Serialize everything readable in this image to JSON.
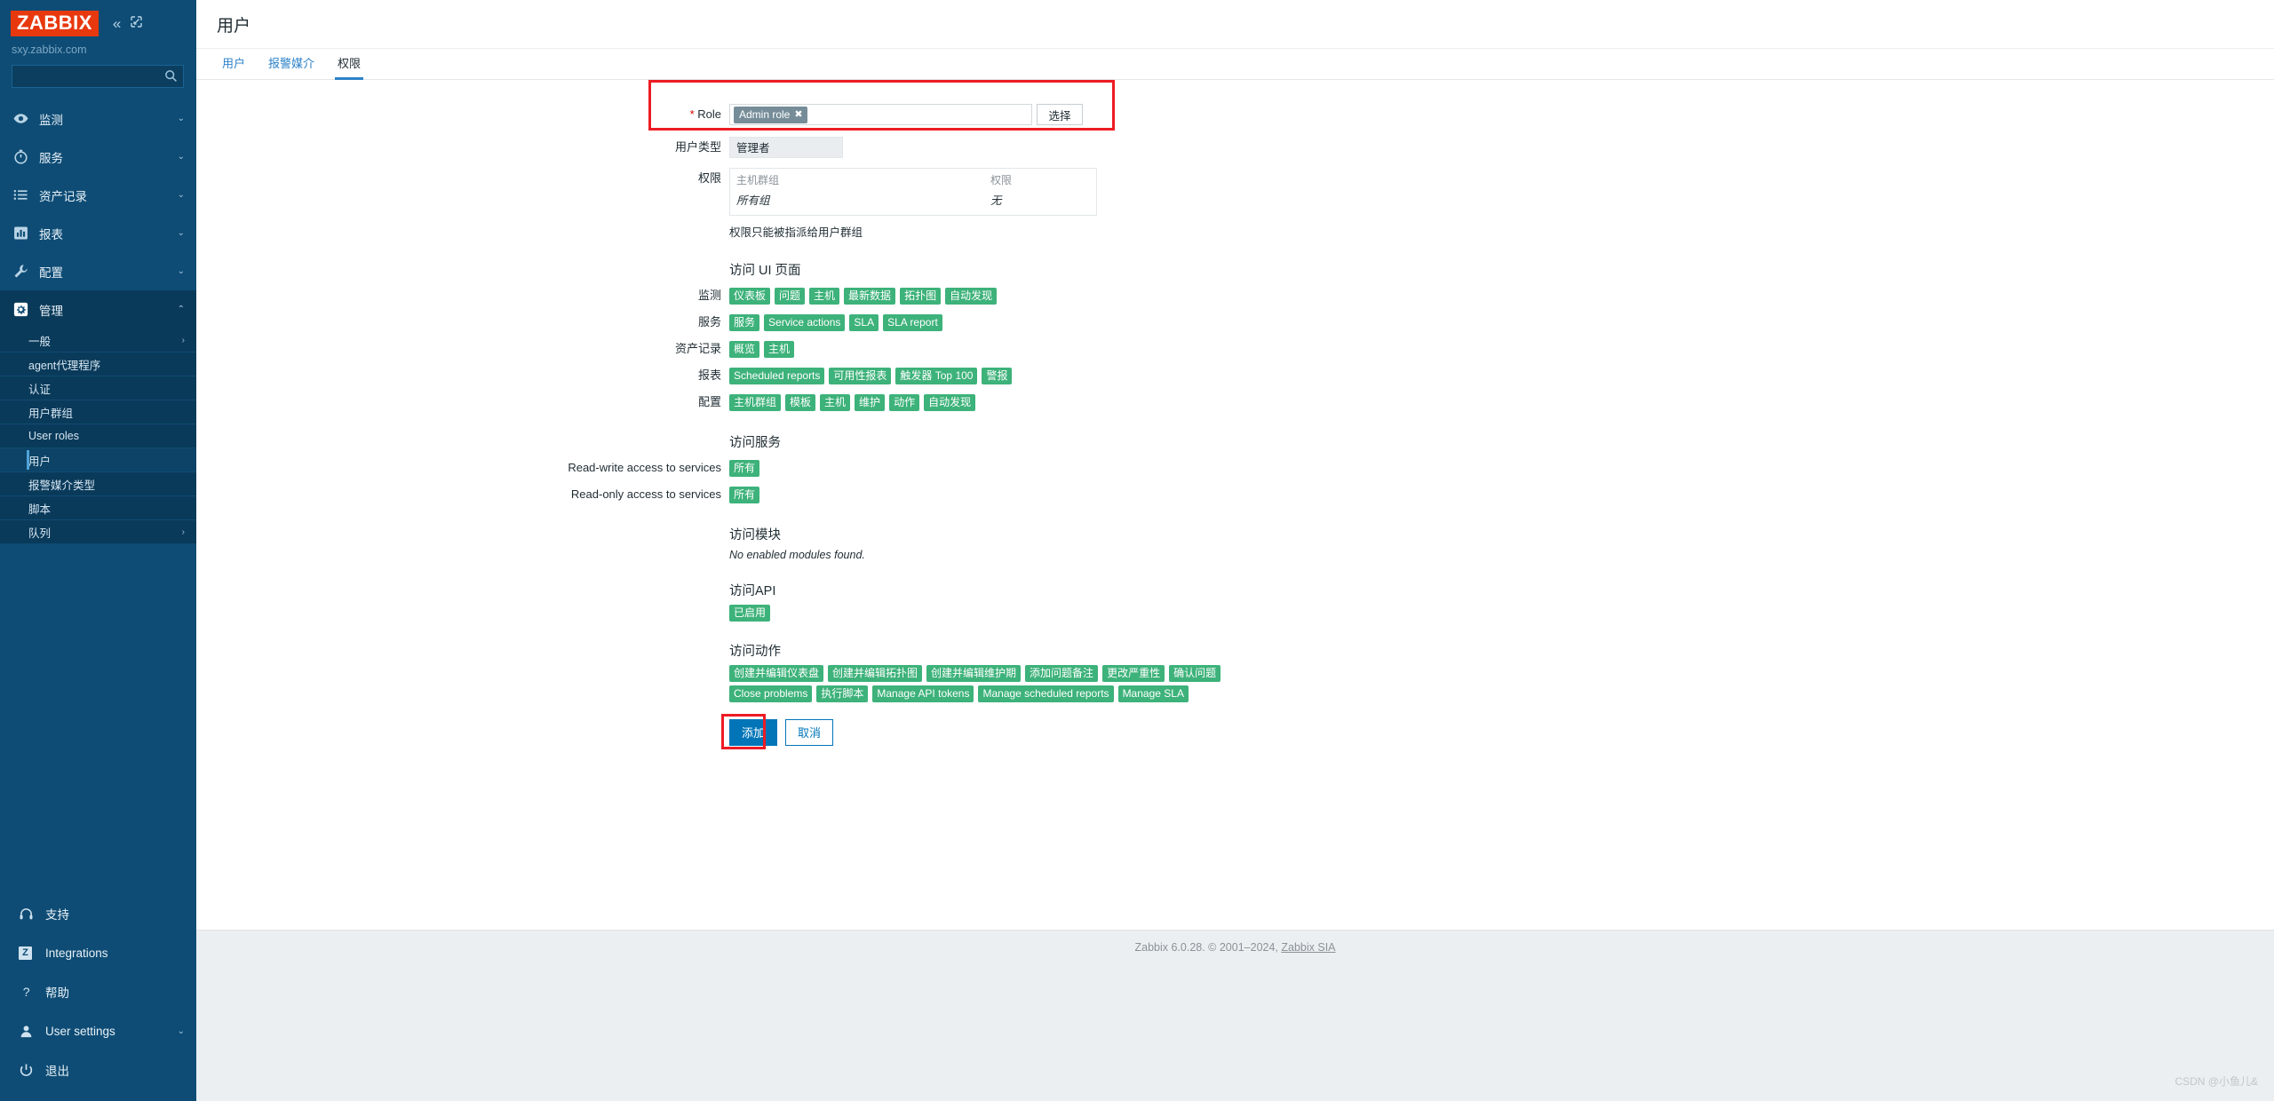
{
  "sidebar": {
    "logo": "ZABBIX",
    "collapse_icon": "chevron-double-left-icon",
    "expand_icon": "expand-icon",
    "server": "sxy.zabbix.com",
    "search": {
      "value": "",
      "placeholder": "",
      "icon": "search-icon"
    },
    "nav": [
      {
        "label": "监测",
        "icon": "eye-icon",
        "chev": "⌄",
        "active": false
      },
      {
        "label": "服务",
        "icon": "clock-icon",
        "chev": "⌄",
        "active": false
      },
      {
        "label": "资产记录",
        "icon": "list-icon",
        "chev": "⌄",
        "active": false
      },
      {
        "label": "报表",
        "icon": "chart-icon",
        "chev": "⌄",
        "active": false
      },
      {
        "label": "配置",
        "icon": "wrench-icon",
        "chev": "⌄",
        "active": false
      },
      {
        "label": "管理",
        "icon": "gear-icon",
        "chev": "⌃",
        "active": true
      }
    ],
    "subnav": [
      {
        "label": "一般",
        "chev": "›",
        "selected": false
      },
      {
        "label": "agent代理程序",
        "chev": "",
        "selected": false
      },
      {
        "label": "认证",
        "chev": "",
        "selected": false
      },
      {
        "label": "用户群组",
        "chev": "",
        "selected": false
      },
      {
        "label": "User roles",
        "chev": "",
        "selected": false
      },
      {
        "label": "用户",
        "chev": "",
        "selected": true
      },
      {
        "label": "报警媒介类型",
        "chev": "",
        "selected": false
      },
      {
        "label": "脚本",
        "chev": "",
        "selected": false
      },
      {
        "label": "队列",
        "chev": "›",
        "selected": false
      }
    ],
    "bottom": [
      {
        "label": "支持",
        "icon": "headset-icon",
        "chev": ""
      },
      {
        "label": "Integrations",
        "icon": "zabbix-z-icon",
        "chev": ""
      },
      {
        "label": "帮助",
        "icon": "question-icon",
        "chev": ""
      },
      {
        "label": "User settings",
        "icon": "user-icon",
        "chev": "⌄"
      },
      {
        "label": "退出",
        "icon": "power-icon",
        "chev": ""
      }
    ]
  },
  "header": {
    "title": "用户"
  },
  "tabs": [
    {
      "label": "用户",
      "active": false
    },
    {
      "label": "报警媒介",
      "active": false
    },
    {
      "label": "权限",
      "active": true
    }
  ],
  "form": {
    "role": {
      "label": "Role",
      "required_mark": "*",
      "chip": "Admin role",
      "chip_close": "✖",
      "select_button": "选择"
    },
    "user_type": {
      "label": "用户类型",
      "value": "管理者"
    },
    "permissions": {
      "label": "权限",
      "col_host_group": "主机群组",
      "col_permission": "权限",
      "row_host_group": "所有组",
      "row_permission": "无"
    },
    "permission_hint": "权限只能被指派给用户群组"
  },
  "ui_access": {
    "title": "访问 UI 页面",
    "groups": [
      {
        "label": "监测",
        "tags": [
          "仪表板",
          "问题",
          "主机",
          "最新数据",
          "拓扑图",
          "自动发现"
        ]
      },
      {
        "label": "服务",
        "tags": [
          "服务",
          "Service actions",
          "SLA",
          "SLA report"
        ]
      },
      {
        "label": "资产记录",
        "tags": [
          "概览",
          "主机"
        ]
      },
      {
        "label": "报表",
        "tags": [
          "Scheduled reports",
          "可用性报表",
          "触发器 Top 100",
          "警报"
        ]
      },
      {
        "label": "配置",
        "tags": [
          "主机群组",
          "模板",
          "主机",
          "维护",
          "动作",
          "自动发现"
        ]
      }
    ]
  },
  "service_access": {
    "title": "访问服务",
    "rows": [
      {
        "label": "Read-write access to services",
        "tag": "所有"
      },
      {
        "label": "Read-only access to services",
        "tag": "所有"
      }
    ]
  },
  "module_access": {
    "title": "访问模块",
    "empty_text": "No enabled modules found."
  },
  "api_access": {
    "title": "访问API",
    "tag": "已启用"
  },
  "action_access": {
    "title": "访问动作",
    "tags": [
      "创建并编辑仪表盘",
      "创建并编辑拓扑图",
      "创建并编辑维护期",
      "添加问题备注",
      "更改严重性",
      "确认问题",
      "Close problems",
      "执行脚本",
      "Manage API tokens",
      "Manage scheduled reports",
      "Manage SLA"
    ]
  },
  "buttons": {
    "submit": "添加",
    "cancel": "取消"
  },
  "footer": {
    "text_prefix": "Zabbix 6.0.28. © 2001–2024, ",
    "link": "Zabbix SIA",
    "watermark": "CSDN @小鱼儿&"
  },
  "colors": {
    "sidebar_bg": "#0E4C75",
    "sidebar_active": "#0A3A5A",
    "logo_red": "#E8380D",
    "accent_blue": "#2C82C9",
    "primary_button": "#0275B8",
    "tag_green": "#3DB27A",
    "highlight_red": "#ED1C24",
    "chip_gray": "#768D99",
    "footer_bg": "#ECEFF1"
  }
}
